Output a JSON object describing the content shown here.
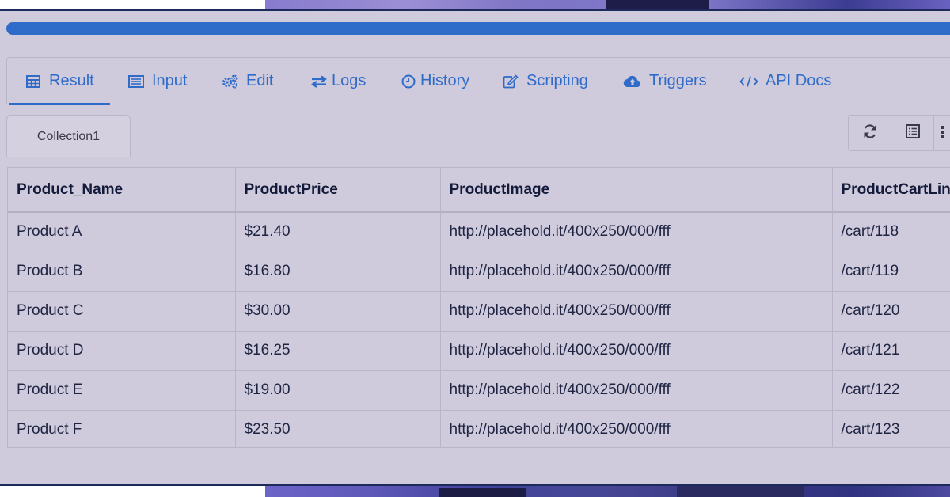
{
  "progress": {
    "fraction": 1.0,
    "color": "#2f6bc9"
  },
  "tabs": [
    {
      "label": "Result",
      "icon": "table-icon",
      "active": true
    },
    {
      "label": "Input",
      "icon": "list-icon",
      "active": false
    },
    {
      "label": "Edit",
      "icon": "gears-icon",
      "active": false
    },
    {
      "label": "Logs",
      "icon": "exchange-icon",
      "active": false
    },
    {
      "label": "History",
      "icon": "clock-icon",
      "active": false
    },
    {
      "label": "Scripting",
      "icon": "edit-icon",
      "active": false
    },
    {
      "label": "Triggers",
      "icon": "cloud-upload-icon",
      "active": false
    },
    {
      "label": "API Docs",
      "icon": "code-icon",
      "active": false
    }
  ],
  "collection": {
    "label": "Collection1"
  },
  "toolbar": {
    "icons": [
      "refresh-icon",
      "list-view-icon",
      "menu-dots-icon"
    ]
  },
  "table": {
    "columns": [
      "Product_Name",
      "ProductPrice",
      "ProductImage",
      "ProductCartLin"
    ],
    "rows": [
      [
        "Product A",
        "$21.40",
        "http://placehold.it/400x250/000/fff",
        "/cart/118"
      ],
      [
        "Product B",
        "$16.80",
        "http://placehold.it/400x250/000/fff",
        "/cart/119"
      ],
      [
        "Product C",
        "$30.00",
        "http://placehold.it/400x250/000/fff",
        "/cart/120"
      ],
      [
        "Product D",
        "$16.25",
        "http://placehold.it/400x250/000/fff",
        "/cart/121"
      ],
      [
        "Product E",
        "$19.00",
        "http://placehold.it/400x250/000/fff",
        "/cart/122"
      ],
      [
        "Product F",
        "$23.50",
        "http://placehold.it/400x250/000/fff",
        "/cart/123"
      ]
    ]
  },
  "colors": {
    "accent": "#2f6bc9",
    "panel": "#cfcbdc",
    "border": "#1e2a5c"
  }
}
